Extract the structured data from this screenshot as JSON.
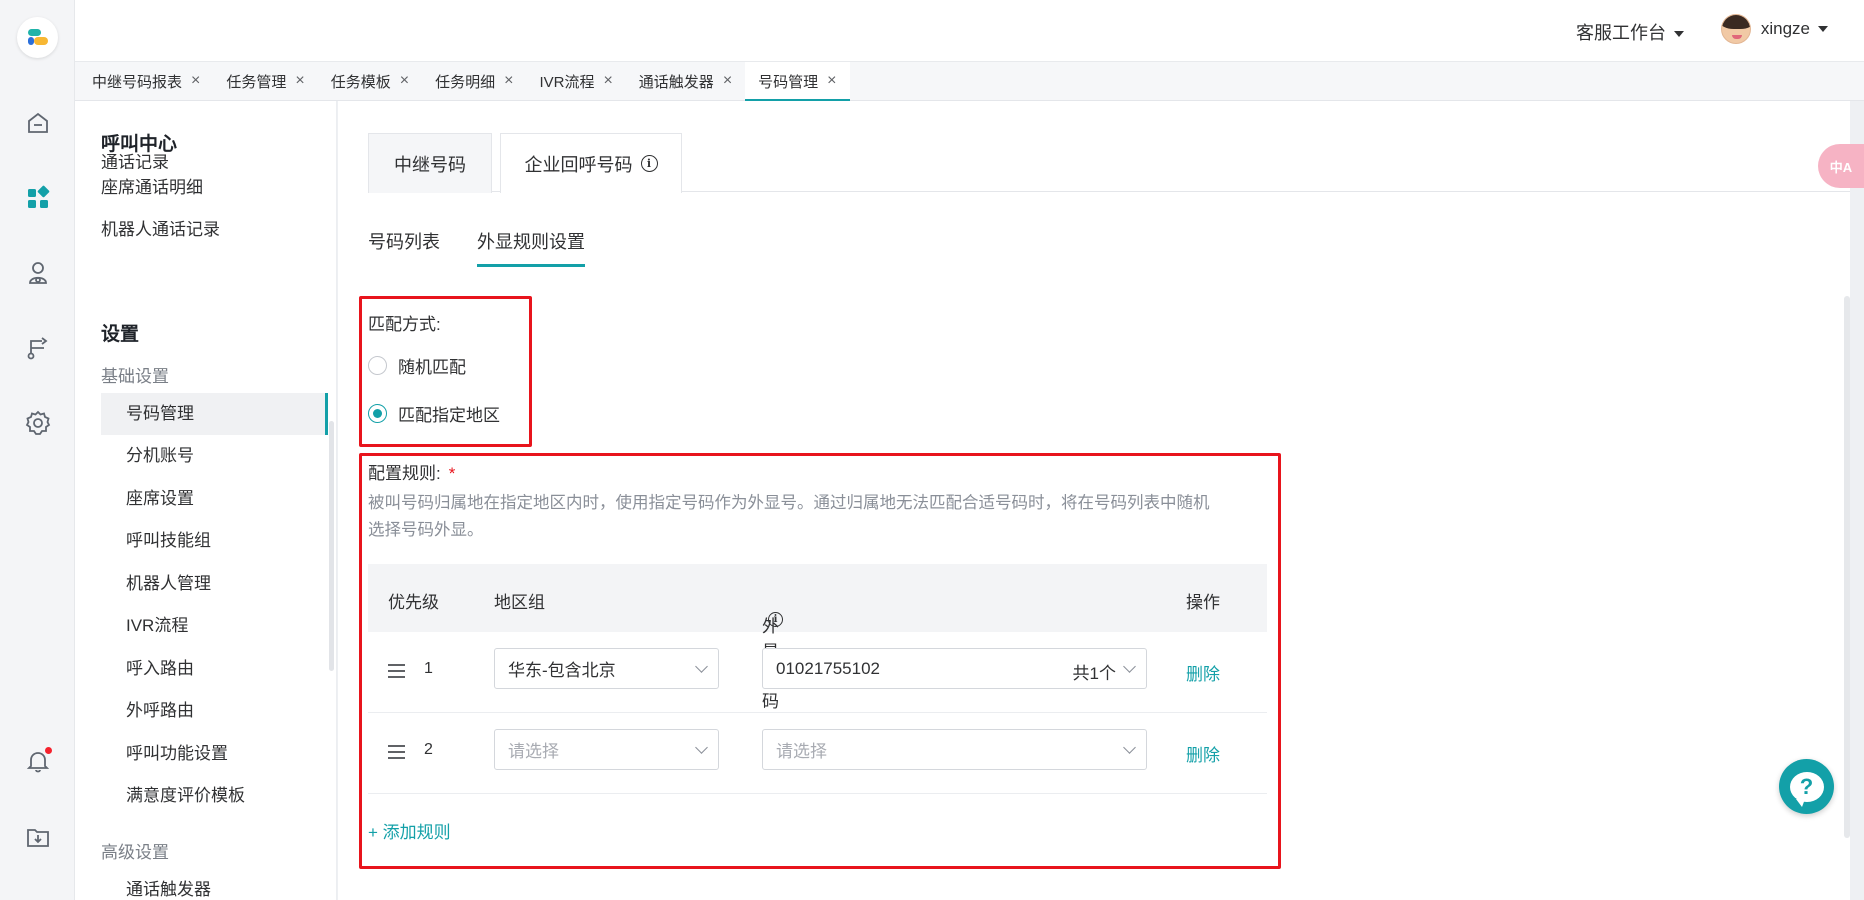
{
  "header": {
    "workspace_label": "客服工作台",
    "username": "xingze"
  },
  "tabs": [
    {
      "label": "中继号码报表"
    },
    {
      "label": "任务管理"
    },
    {
      "label": "任务模板"
    },
    {
      "label": "任务明细"
    },
    {
      "label": "IVR流程"
    },
    {
      "label": "通话触发器"
    },
    {
      "label": "号码管理"
    }
  ],
  "active_tab": "号码管理",
  "close_glyph": "×",
  "sidenav": {
    "section_call_center": "呼叫中心",
    "items_top": [
      "通话记录",
      "座席通话明细",
      "机器人通话记录"
    ],
    "section_settings": "设置",
    "group_basic": "基础设置",
    "basic_items": [
      "号码管理",
      "分机账号",
      "座席设置",
      "呼叫技能组",
      "机器人管理",
      "IVR流程",
      "呼入路由",
      "外呼路由",
      "呼叫功能设置",
      "满意度评价模板"
    ],
    "group_advanced": "高级设置",
    "advanced_items": [
      "通话触发器"
    ]
  },
  "outer_tabs": {
    "relay": "中继号码",
    "callback": "企业回呼号码",
    "info_glyph": "i"
  },
  "inner_tabs": {
    "list": "号码列表",
    "rules": "外显规则设置"
  },
  "match": {
    "label": "匹配方式:",
    "options": [
      "随机匹配",
      "匹配指定地区"
    ],
    "selected": "匹配指定地区"
  },
  "rules": {
    "label": "配置规则:",
    "required_mark": "*",
    "description_line1": "被叫号码归属地在指定地区内时，使用指定号码作为外显号。通过归属地无法匹配合适号码时，将在号码列表中随机",
    "description_line2": "选择号码外显。",
    "columns": {
      "priority": "优先级",
      "region": "地区组",
      "number": "外显号码",
      "action": "操作"
    },
    "rows": [
      {
        "priority": "1",
        "region": "华东-包含北京",
        "region_placeholder": "",
        "number": "01021755102",
        "number_placeholder": "",
        "count": "共1个",
        "delete": "删除"
      },
      {
        "priority": "2",
        "region": "",
        "region_placeholder": "请选择",
        "number": "",
        "number_placeholder": "请选择",
        "count": "",
        "delete": "删除"
      }
    ],
    "add_rule": "+ 添加规则"
  },
  "widgets": {
    "translate_glyph": "中A",
    "help_glyph": "?"
  },
  "colors": {
    "accent": "#13a0a8",
    "highlight_box": "#e8141c",
    "notification_dot": "#f5222d"
  }
}
